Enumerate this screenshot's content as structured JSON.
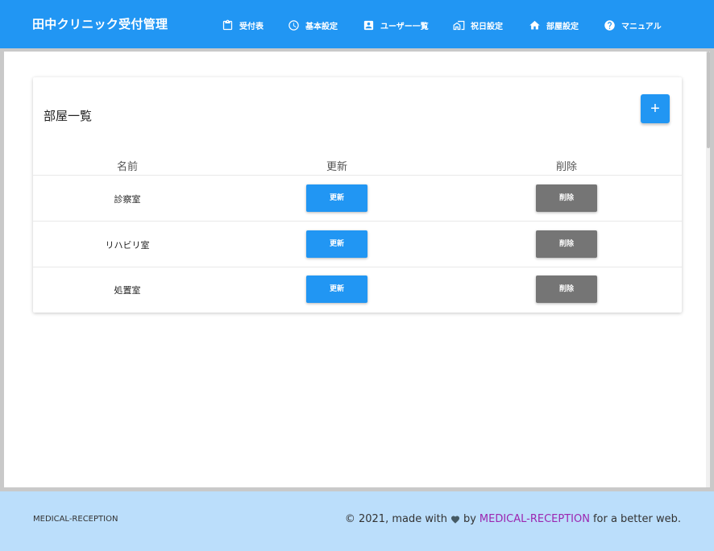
{
  "header": {
    "brand": "田中クリニック受付管理",
    "nav": [
      {
        "label": "受付表",
        "icon": "clipboard-icon"
      },
      {
        "label": "基本設定",
        "icon": "clock-icon"
      },
      {
        "label": "ユーザー一覧",
        "icon": "account-box-icon"
      },
      {
        "label": "祝日設定",
        "icon": "holiday-house-icon"
      },
      {
        "label": "部屋設定",
        "icon": "home-icon"
      },
      {
        "label": "マニュアル",
        "icon": "help-circle-icon"
      }
    ],
    "color": "#2196f3"
  },
  "card": {
    "title": "部屋一覧",
    "add_label": "+",
    "columns": [
      "名前",
      "更新",
      "削除"
    ],
    "rows": [
      {
        "name": "診察室",
        "update": "更新",
        "delete": "削除"
      },
      {
        "name": "リハビリ室",
        "update": "更新",
        "delete": "削除"
      },
      {
        "name": "処置室",
        "update": "更新",
        "delete": "削除"
      }
    ]
  },
  "footer": {
    "left": "MEDICAL-RECEPTION",
    "prefix": "© 2021, made with",
    "by": "by",
    "link": "MEDICAL-RECEPTION",
    "suffix": "for a better web.",
    "link_color": "#9c27b0",
    "background": "#bbdefb"
  }
}
